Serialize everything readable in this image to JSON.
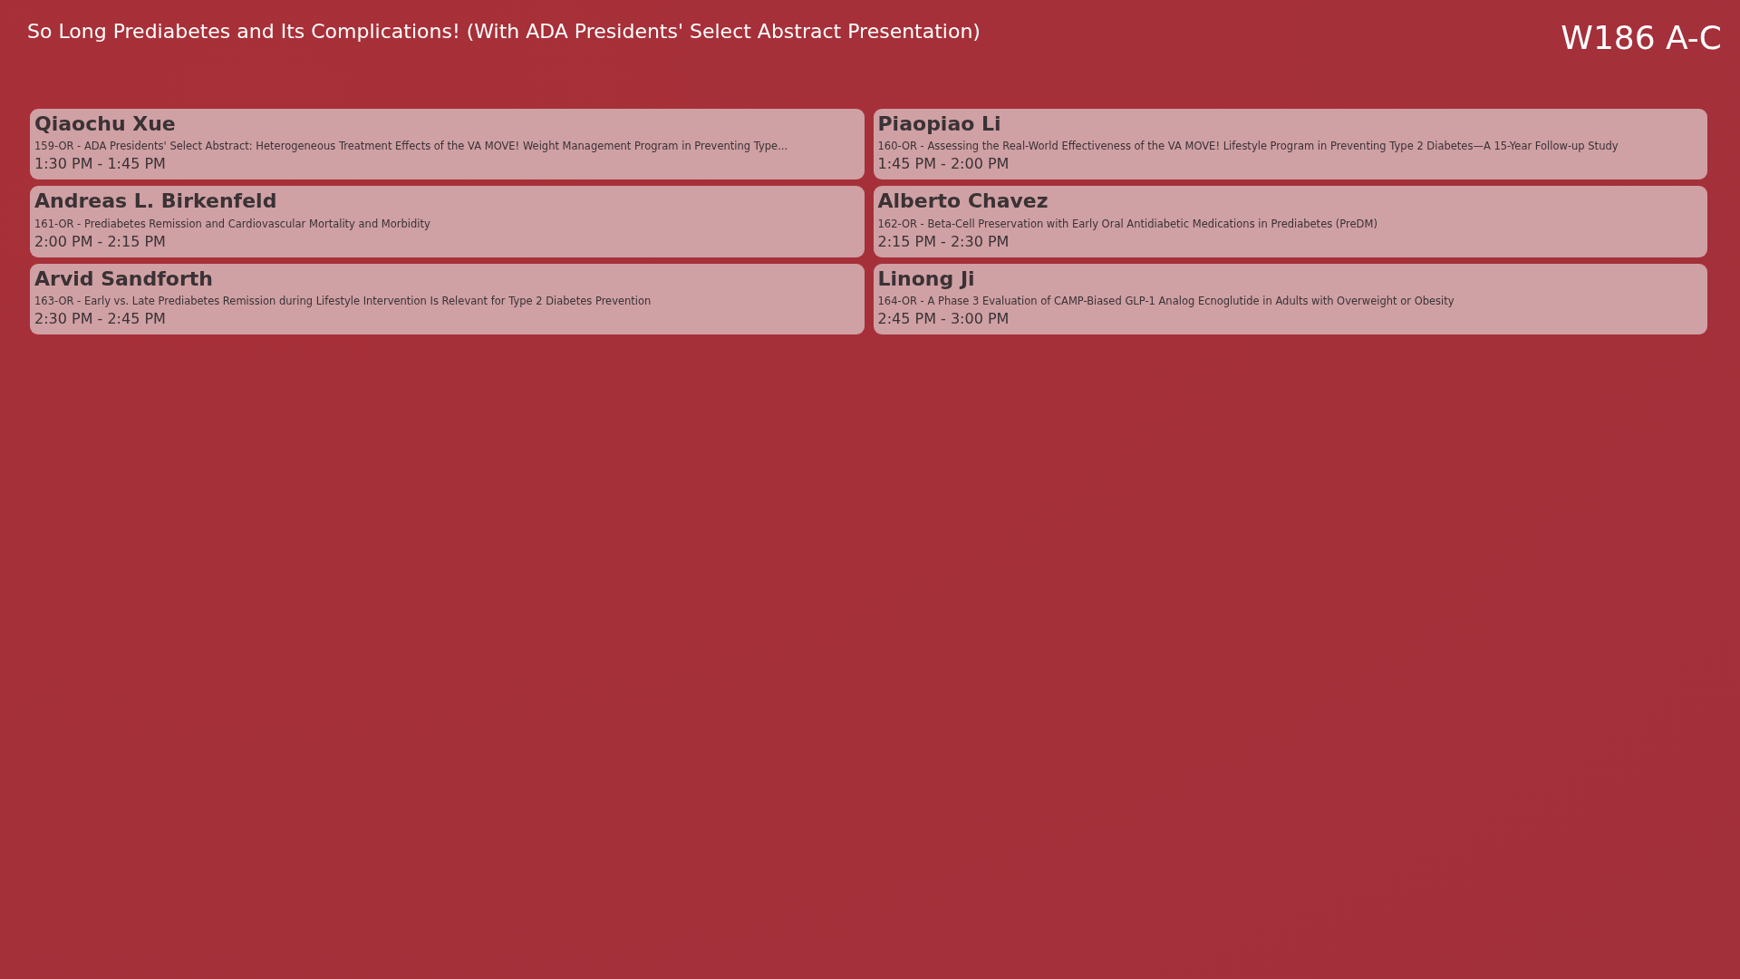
{
  "session_title": "So Long Prediabetes and Its Complications! (With ADA Presidents' Select Abstract Presentation)",
  "room": "W186 A-C",
  "talks": [
    {
      "speaker": "Qiaochu Xue",
      "abstract": "159-OR - ADA Presidents' Select Abstract: Heterogeneous Treatment Effects of the VA MOVE! Weight Management Program in Preventing Type...",
      "time": "1:30 PM - 1:45 PM"
    },
    {
      "speaker": "Piaopiao Li",
      "abstract": "160-OR - Assessing the Real-World Effectiveness of the VA MOVE! Lifestyle Program in Preventing Type 2 Diabetes—A 15-Year Follow-up Study",
      "time": "1:45 PM - 2:00 PM"
    },
    {
      "speaker": "Andreas L. Birkenfeld",
      "abstract": "161-OR - Prediabetes Remission and Cardiovascular Mortality and Morbidity",
      "time": "2:00 PM - 2:15 PM"
    },
    {
      "speaker": "Alberto Chavez",
      "abstract": "162-OR - Beta-Cell Preservation with Early Oral Antidiabetic Medications in Prediabetes (PreDM)",
      "time": "2:15 PM - 2:30 PM"
    },
    {
      "speaker": "Arvid Sandforth",
      "abstract": "163-OR - Early vs. Late Prediabetes Remission during Lifestyle Intervention Is Relevant for Type 2 Diabetes Prevention",
      "time": "2:30 PM - 2:45 PM"
    },
    {
      "speaker": "Linong Ji",
      "abstract": "164-OR - A Phase 3 Evaluation of CAMP-Biased GLP-1 Analog Ecnoglutide in Adults with Overweight or Obesity",
      "time": "2:45 PM - 3:00 PM"
    }
  ]
}
